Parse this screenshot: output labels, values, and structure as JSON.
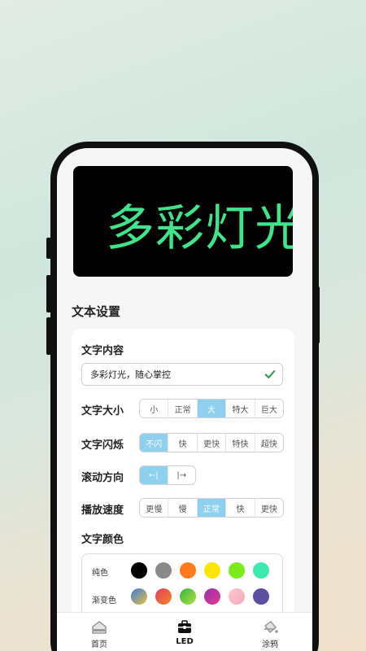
{
  "led": {
    "text": "多彩灯光"
  },
  "settings": {
    "section_title": "文本设置",
    "content": {
      "label": "文字内容",
      "value": "多彩灯光，随心掌控"
    },
    "size": {
      "label": "文字大小",
      "options": [
        "小",
        "正常",
        "大",
        "特大",
        "巨大"
      ],
      "selected": "大"
    },
    "blink": {
      "label": "文字闪烁",
      "options": [
        "不闪",
        "快",
        "更快",
        "特快",
        "超快"
      ],
      "selected": "不闪"
    },
    "direction": {
      "label": "滚动方向",
      "options": [
        "←|",
        "|→"
      ],
      "selected": "←|"
    },
    "speed": {
      "label": "播放速度",
      "options": [
        "更慢",
        "慢",
        "正常",
        "快",
        "更快"
      ],
      "selected": "正常"
    },
    "color": {
      "label": "文字颜色",
      "solid_label": "纯色",
      "gradient_label": "渐变色",
      "solid": [
        "#000000",
        "#8a8a8a",
        "#ff7a1a",
        "#ffe600",
        "#7bea19",
        "#3ee8b0"
      ],
      "gradient": [
        [
          "#3b78e7",
          "#e7c33b"
        ],
        [
          "#e73b5f",
          "#f08a2a"
        ],
        [
          "#2fb24a",
          "#b8e23a"
        ],
        [
          "#9a2fb2",
          "#e23a8a"
        ],
        [
          "#f7c9d2",
          "#f7a8b8"
        ],
        [
          "#5a4fa0",
          "#5a4fa0"
        ]
      ]
    }
  },
  "tabs": [
    {
      "label": "首页",
      "icon": "home-icon"
    },
    {
      "label": "LED",
      "icon": "briefcase-icon"
    },
    {
      "label": "涂鸦",
      "icon": "paint-bucket-icon"
    }
  ],
  "colors": {
    "led_text": "#3fe58a",
    "accent": "#8fd0ef",
    "check": "#2e9e4a"
  }
}
